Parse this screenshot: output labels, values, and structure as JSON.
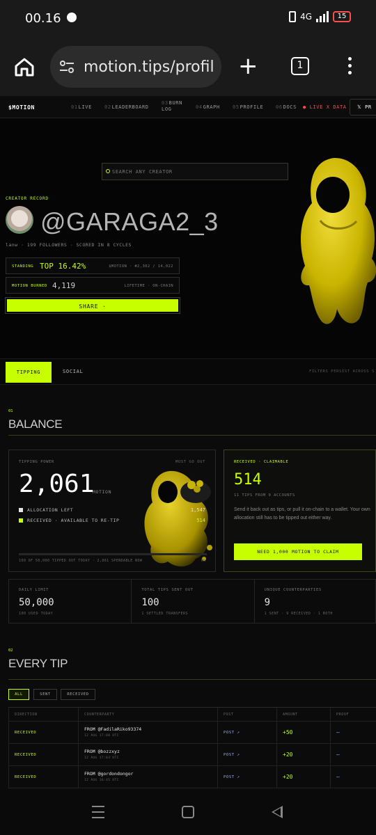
{
  "status_bar": {
    "time": "00.16",
    "battery": "15",
    "network": "4G"
  },
  "browser": {
    "url": "motion.tips/profil",
    "tab_count": "1"
  },
  "site_nav": {
    "logo": "$MOTION",
    "items": [
      {
        "num": "01",
        "label": "LIVE"
      },
      {
        "num": "02",
        "label": "LEADERBOARD"
      },
      {
        "num": "03",
        "label": "BURN LOG"
      },
      {
        "num": "04",
        "label": "GRAPH"
      },
      {
        "num": "05",
        "label": "PROFILE"
      },
      {
        "num": "06",
        "label": "DOCS"
      }
    ],
    "live_data": "LIVE X DATA",
    "x_button": "PR"
  },
  "hero": {
    "search_placeholder": "SEARCH ANY CREATOR",
    "creator_label": "CREATOR RECORD",
    "handle": "@GARAGA2_3",
    "meta": "lanw · 199 FOLLOWERS · SCORED IN 8 CYCLES",
    "standing": {
      "label": "STANDING",
      "value": "TOP 16.42%",
      "aux": "$MOTION · #2,302 / 14,022"
    },
    "burned": {
      "label": "MOTION BURNED",
      "value": "4,119",
      "aux": "LIFETIME · ON-CHAIN"
    },
    "share_label": "SHARE ·"
  },
  "tabs": {
    "tipping": "TIPPING",
    "social": "SOCIAL",
    "note": "FILTERS PERSIST ACROSS S"
  },
  "balance": {
    "num": "01",
    "title": "BALANCE",
    "power": {
      "label": "TIPPING POWER",
      "must": "MUST GO OUT",
      "value": "2,061",
      "unit": "MOTION",
      "allocation_label": "ALLOCATION LEFT",
      "allocation_value": "1,547",
      "received_label": "RECEIVED · AVAILABLE TO RE-TIP",
      "received_value": "514",
      "progress_fraction": 0.0,
      "caption": "100 OF 50,000 TIPPED OUT TODAY · 2,061 SPENDABLE NOW",
      "percent": "0%"
    },
    "claim": {
      "label": "RECEIVED · CLAIMABLE",
      "value": "514",
      "sub": "11 TIPS FROM 9 ACCOUNTS",
      "desc": "Send it back out as tips, or pull it on-chain to a wallet. Your own allocation still has to be tipped out either way.",
      "button": "NEED 1,000 MOTION TO CLAIM"
    },
    "stats": [
      {
        "label": "DAILY LIMIT",
        "value": "50,000",
        "sub": "100 USED TODAY"
      },
      {
        "label": "TOTAL TIPS SENT OUT",
        "value": "100",
        "sub": "1 SETTLED TRANSFERS"
      },
      {
        "label": "UNIQUE COUNTERPARTIES",
        "value": "9",
        "sub": "1 SENT · 9 RECEIVED · 1 BOTH"
      }
    ]
  },
  "tips": {
    "num": "02",
    "title": "EVERY TIP",
    "filters": [
      "ALL",
      "SENT",
      "RECEIVED"
    ],
    "columns": [
      "DIRECTION",
      "COUNTERPARTY",
      "POST",
      "AMOUNT",
      "PROOF"
    ],
    "rows": [
      {
        "direction": "RECEIVED",
        "from": "FROM @FadilaRiko93374",
        "date": "12 AUG 17:08 UTC",
        "post": "POST ↗",
        "amount": "+50",
        "proof": "–"
      },
      {
        "direction": "RECEIVED",
        "from": "FROM @bozzxyz",
        "date": "12 AUG 17:03 UTC",
        "post": "POST ↗",
        "amount": "+20",
        "proof": "–"
      },
      {
        "direction": "RECEIVED",
        "from": "FROM @gordondongor",
        "date": "12 AUG 16:45 UTC",
        "post": "POST ↗",
        "amount": "+20",
        "proof": "–"
      }
    ]
  },
  "colors": {
    "accent": "#c8ff00",
    "background": "#0b0b0b",
    "mascot": "#c9b400",
    "live": "#ff4b4b"
  }
}
